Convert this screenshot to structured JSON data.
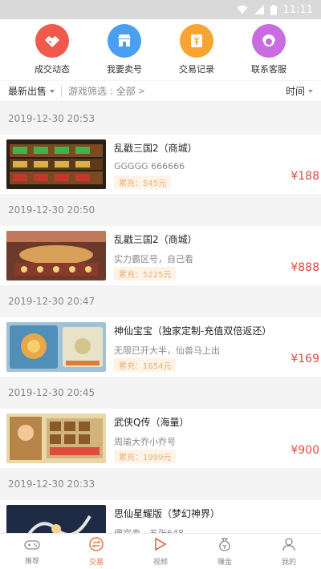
{
  "status": {
    "time": "11:11",
    "icons": [
      "wifi-icon",
      "signal-icon",
      "battery-icon"
    ]
  },
  "quick": [
    {
      "label": "成交动态",
      "icon": "handshake-icon",
      "color": "#ef5a4c"
    },
    {
      "label": "我要卖号",
      "icon": "shop-icon",
      "color": "#4a9ff0"
    },
    {
      "label": "交易记录",
      "icon": "coin-record-icon",
      "color": "#f7a530"
    },
    {
      "label": "联系客服",
      "icon": "service-icon",
      "color": "#c86ce0"
    }
  ],
  "filter": {
    "sort": "最新出售",
    "game": "游戏筛选 : 全部",
    "time": "时间"
  },
  "entries": [
    {
      "date": "2019-12-30 20:53",
      "title": "乱戳三国2（商城）",
      "sub": "GGGGG 666666",
      "badge": "累充：545元",
      "price": "¥188"
    },
    {
      "date": "2019-12-30 20:50",
      "title": "乱戳三国2（商城）",
      "sub": "实力霸区号，自己看",
      "badge": "累充：5225元",
      "price": "¥888"
    },
    {
      "date": "2019-12-30 20:47",
      "title": "神仙宝宝（独家定制-充值双倍返还）",
      "sub": "无限已开大半，仙兽马上出",
      "badge": "累充：1654元",
      "price": "¥169"
    },
    {
      "date": "2019-12-30 20:45",
      "title": "武侠Q传（海量）",
      "sub": "周瑜大乔小乔号",
      "badge": "累充：1999元",
      "price": "¥900"
    },
    {
      "date": "2019-12-30 20:33",
      "title": "思仙星耀版（梦幻神界）",
      "sub": "便宜卖，五张648",
      "badge": "",
      "price": ""
    }
  ],
  "tabs": [
    {
      "label": "推荐",
      "icon": "gamepad-icon",
      "active": false
    },
    {
      "label": "交易",
      "icon": "exchange-icon",
      "active": true
    },
    {
      "label": "视频",
      "icon": "play-icon",
      "active": false
    },
    {
      "label": "赚金",
      "icon": "money-bag-icon",
      "active": false
    },
    {
      "label": "我的",
      "icon": "user-icon",
      "active": false
    }
  ],
  "colors": {
    "accent": "#e76b3c",
    "price": "#e04a3f",
    "badge_text": "#e9b07a"
  }
}
